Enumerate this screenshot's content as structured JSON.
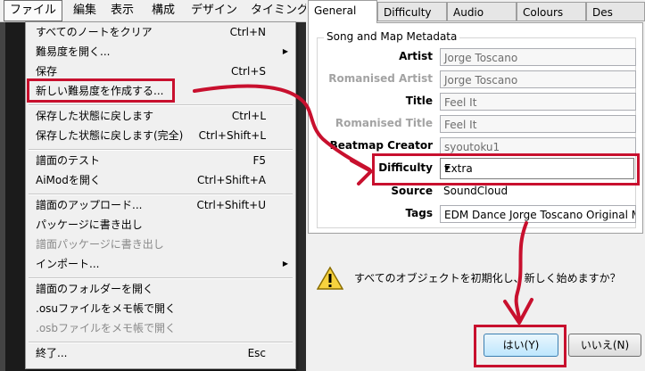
{
  "menubar": {
    "items": [
      "ファイル",
      "編集",
      "表示",
      "構成",
      "デザイン",
      "タイミング"
    ]
  },
  "file_menu": {
    "items": [
      {
        "label": "すべてのノートをクリア",
        "shortcut": "Ctrl+N"
      },
      {
        "label": "難易度を開く...",
        "shortcut": ""
      },
      {
        "label": "保存",
        "shortcut": "Ctrl+S"
      },
      {
        "label": "新しい難易度を作成する...",
        "shortcut": ""
      },
      {
        "label": "保存した状態に戻します",
        "shortcut": "Ctrl+L"
      },
      {
        "label": "保存した状態に戻します(完全)",
        "shortcut": "Ctrl+Shift+L"
      },
      {
        "label": "譜面のテスト",
        "shortcut": "F5"
      },
      {
        "label": "AiModを開く",
        "shortcut": "Ctrl+Shift+A"
      },
      {
        "label": "譜面のアップロード...",
        "shortcut": "Ctrl+Shift+U"
      },
      {
        "label": "パッケージに書き出し",
        "shortcut": ""
      },
      {
        "label": "譜面パッケージに書き出し",
        "shortcut": ""
      },
      {
        "label": "インポート...",
        "shortcut": ""
      },
      {
        "label": "譜面のフォルダーを開く",
        "shortcut": ""
      },
      {
        "label": ".osuファイルをメモ帳で開く",
        "shortcut": ""
      },
      {
        "label": ".osbファイルをメモ帳で開く",
        "shortcut": ""
      },
      {
        "label": "終了...",
        "shortcut": "Esc"
      }
    ]
  },
  "dialog": {
    "tabs": [
      "General",
      "Difficulty",
      "Audio",
      "Colours",
      "Des"
    ],
    "group_title": "Song and Map Metadata",
    "fields": {
      "artist_label": "Artist",
      "artist": "Jorge Toscano",
      "romanised_artist_label": "Romanised Artist",
      "romanised_artist": "Jorge Toscano",
      "title_label": "Title",
      "title": "Feel It",
      "romanised_title_label": "Romanised Title",
      "romanised_title": "Feel It",
      "creator_label": "Beatmap Creator",
      "creator": "syoutoku1",
      "difficulty_label": "Difficulty",
      "difficulty": "Extra",
      "source_label": "Source",
      "source": "SoundCloud",
      "tags_label": "Tags",
      "tags": "EDM Dance Jorge Toscano Original M"
    },
    "message": "すべてのオブジェクトを初期化し、新しく始めますか？",
    "yes_button": "はい(Y)",
    "no_button": "いいえ(N)"
  },
  "colors": {
    "highlight": "#c8102e",
    "accent": "#3c7fb1"
  }
}
